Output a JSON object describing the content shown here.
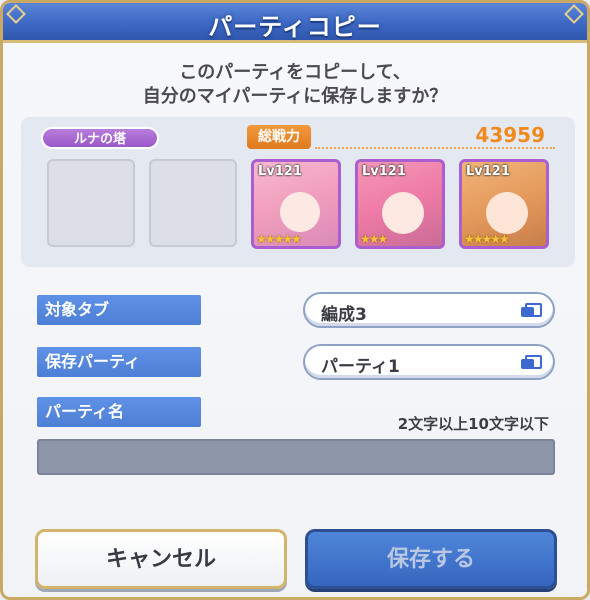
{
  "dialog": {
    "title": "パーティコピー",
    "question_line1": "このパーティをコピーして、",
    "question_line2": "自分のマイパーティに保存しますか？"
  },
  "team": {
    "tower_tag": "ルナの塔",
    "power_label": "総戦力",
    "power_value": "43959",
    "characters": [
      {
        "level": "Lv121",
        "stars": "★★★★★"
      },
      {
        "level": "Lv121",
        "stars": "★★★"
      },
      {
        "level": "Lv121",
        "stars": "★★★★★"
      }
    ]
  },
  "form": {
    "target_tab_label": "対象タブ",
    "target_tab_value": "編成3",
    "save_party_label": "保存パーティ",
    "save_party_value": "パーティ1",
    "party_name_label": "パーティ名",
    "party_name_hint": "2文字以上10文字以下",
    "party_name_value": ""
  },
  "buttons": {
    "cancel": "キャンセル",
    "save": "保存する"
  },
  "colors": {
    "title_blue": "#3d68c4",
    "gold_border": "#c9a964",
    "label_blue": "#4d7fd6",
    "power_orange": "#f08a1e",
    "character_frame": "#a95fcf"
  }
}
